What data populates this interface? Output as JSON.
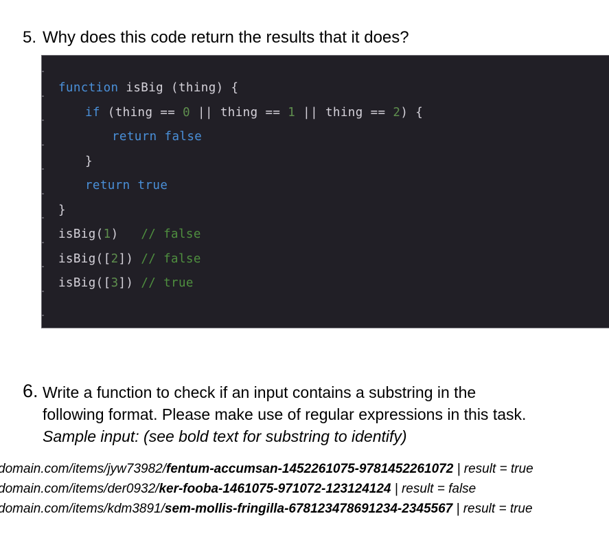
{
  "document": {
    "background_color": "#ffffff",
    "text_color": "#000000"
  },
  "questions": [
    {
      "marker": "5.",
      "text": "Why does this code return the results that it does?"
    },
    {
      "marker": "6.",
      "line1": "Write a function to check if an input contains a substring in the",
      "line2": "following format. Please make use of regular expressions in this task.",
      "sample_note": "Sample input: (see bold text for substring to identify)"
    }
  ],
  "code_block": {
    "background_color": "#211f26",
    "language": "javascript",
    "colors": {
      "keyword": "#4a90d9",
      "number": "#5f8f4e",
      "comment": "#4f8f3f",
      "default": "#d5d2da"
    },
    "lines": [
      {
        "indent": 0,
        "tokens": [
          {
            "t": "function",
            "c": "kw"
          },
          {
            "t": " isBig (thing) {",
            "c": "pun"
          }
        ]
      },
      {
        "indent": 1,
        "tokens": [
          {
            "t": "if",
            "c": "kw"
          },
          {
            "t": " (thing == ",
            "c": "pun"
          },
          {
            "t": "0",
            "c": "num"
          },
          {
            "t": " || thing == ",
            "c": "pun"
          },
          {
            "t": "1",
            "c": "num"
          },
          {
            "t": " || thing == ",
            "c": "pun"
          },
          {
            "t": "2",
            "c": "num"
          },
          {
            "t": ") {",
            "c": "pun"
          }
        ]
      },
      {
        "indent": 2,
        "tokens": [
          {
            "t": "return false",
            "c": "kw"
          }
        ]
      },
      {
        "indent": 1,
        "tokens": [
          {
            "t": "}",
            "c": "pun"
          }
        ]
      },
      {
        "indent": 1,
        "tokens": [
          {
            "t": "return true",
            "c": "kw"
          }
        ]
      },
      {
        "indent": 0,
        "tokens": [
          {
            "t": "}",
            "c": "pun"
          }
        ]
      },
      {
        "indent": 0,
        "tokens": [
          {
            "t": "isBig(",
            "c": "pun"
          },
          {
            "t": "1",
            "c": "num"
          },
          {
            "t": ")   ",
            "c": "pun"
          },
          {
            "t": "// false",
            "c": "cmt"
          }
        ]
      },
      {
        "indent": 0,
        "tokens": [
          {
            "t": "isBig([",
            "c": "pun"
          },
          {
            "t": "2",
            "c": "num"
          },
          {
            "t": "]) ",
            "c": "pun"
          },
          {
            "t": "// false",
            "c": "cmt"
          }
        ]
      },
      {
        "indent": 0,
        "tokens": [
          {
            "t": "isBig([",
            "c": "pun"
          },
          {
            "t": "3",
            "c": "num"
          },
          {
            "t": "]) ",
            "c": "pun"
          },
          {
            "t": "// true",
            "c": "cmt"
          }
        ]
      }
    ]
  },
  "samples": [
    {
      "prefix": "domain.com/items/jyw73982/",
      "bold": "fentum-accumsan-1452261075-9781452261072",
      "result": " | result = true"
    },
    {
      "prefix": "domain.com/items/der0932/",
      "bold": "ker-fooba-1461075-971072-123124124",
      "result": " | result = false"
    },
    {
      "prefix": "domain.com/items/kdm3891/",
      "bold": "sem-mollis-fringilla-678123478691234-2345567",
      "result": " | result = true"
    }
  ]
}
